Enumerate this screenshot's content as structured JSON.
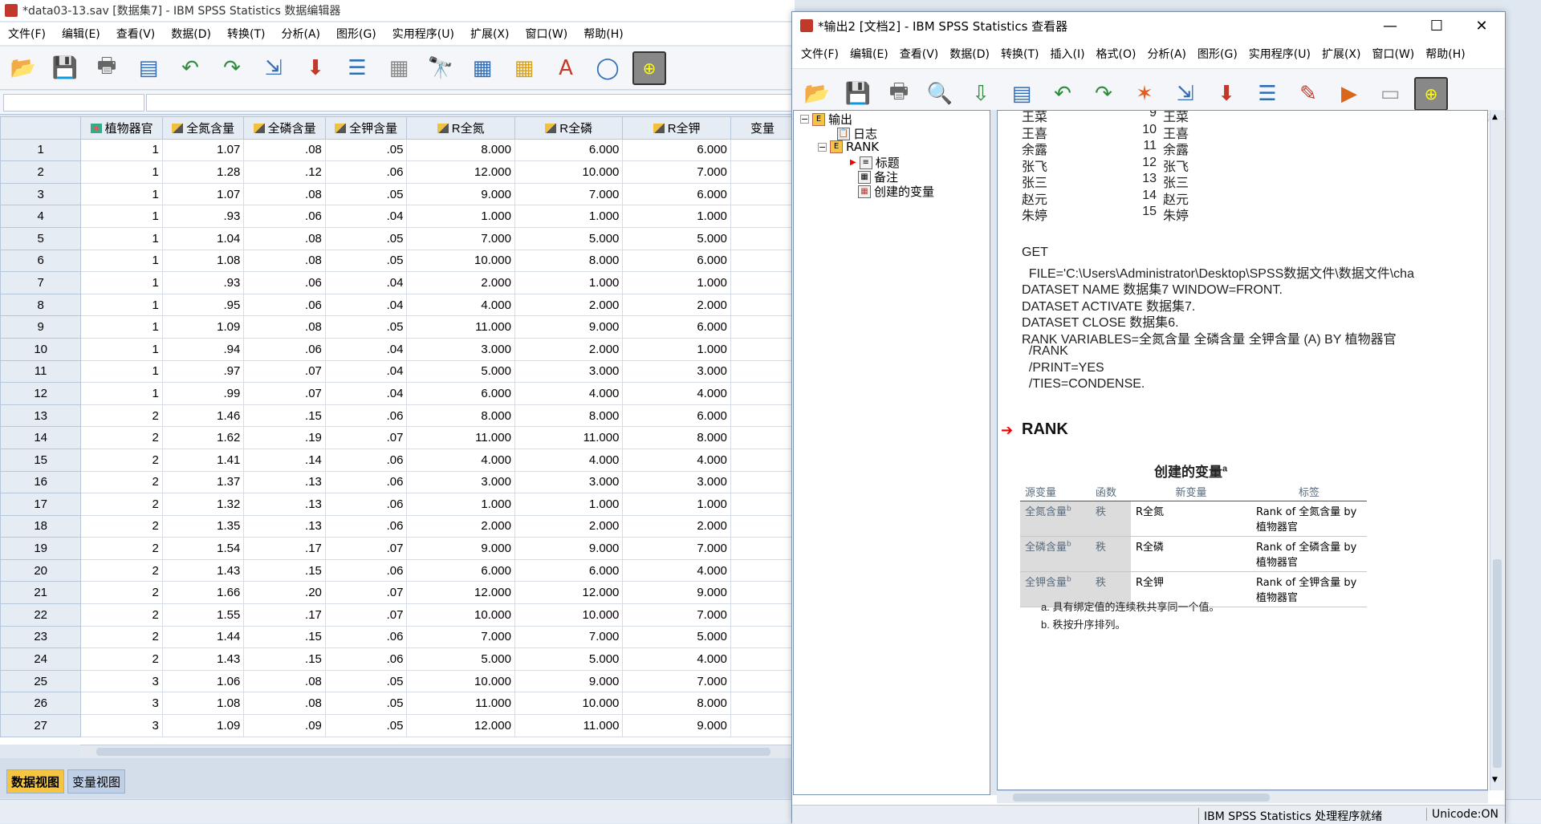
{
  "editor": {
    "title": "*data03-13.sav [数据集7] - IBM SPSS Statistics 数据编辑器",
    "menu": [
      "文件(F)",
      "编辑(E)",
      "查看(V)",
      "数据(D)",
      "转换(T)",
      "分析(A)",
      "图形(G)",
      "实用程序(U)",
      "扩展(X)",
      "窗口(W)",
      "帮助(H)"
    ],
    "columns": [
      "植物器官",
      "全氮含量",
      "全磷含量",
      "全钾含量",
      "R全氮",
      "R全磷",
      "R全钾",
      "变量"
    ],
    "rows": [
      [
        "1",
        "1",
        "1.07",
        ".08",
        ".05",
        "8.000",
        "6.000",
        "6.000"
      ],
      [
        "2",
        "1",
        "1.28",
        ".12",
        ".06",
        "12.000",
        "10.000",
        "7.000"
      ],
      [
        "3",
        "1",
        "1.07",
        ".08",
        ".05",
        "9.000",
        "7.000",
        "6.000"
      ],
      [
        "4",
        "1",
        ".93",
        ".06",
        ".04",
        "1.000",
        "1.000",
        "1.000"
      ],
      [
        "5",
        "1",
        "1.04",
        ".08",
        ".05",
        "7.000",
        "5.000",
        "5.000"
      ],
      [
        "6",
        "1",
        "1.08",
        ".08",
        ".05",
        "10.000",
        "8.000",
        "6.000"
      ],
      [
        "7",
        "1",
        ".93",
        ".06",
        ".04",
        "2.000",
        "1.000",
        "1.000"
      ],
      [
        "8",
        "1",
        ".95",
        ".06",
        ".04",
        "4.000",
        "2.000",
        "2.000"
      ],
      [
        "9",
        "1",
        "1.09",
        ".08",
        ".05",
        "11.000",
        "9.000",
        "6.000"
      ],
      [
        "10",
        "1",
        ".94",
        ".06",
        ".04",
        "3.000",
        "2.000",
        "1.000"
      ],
      [
        "11",
        "1",
        ".97",
        ".07",
        ".04",
        "5.000",
        "3.000",
        "3.000"
      ],
      [
        "12",
        "1",
        ".99",
        ".07",
        ".04",
        "6.000",
        "4.000",
        "4.000"
      ],
      [
        "13",
        "2",
        "1.46",
        ".15",
        ".06",
        "8.000",
        "8.000",
        "6.000"
      ],
      [
        "14",
        "2",
        "1.62",
        ".19",
        ".07",
        "11.000",
        "11.000",
        "8.000"
      ],
      [
        "15",
        "2",
        "1.41",
        ".14",
        ".06",
        "4.000",
        "4.000",
        "4.000"
      ],
      [
        "16",
        "2",
        "1.37",
        ".13",
        ".06",
        "3.000",
        "3.000",
        "3.000"
      ],
      [
        "17",
        "2",
        "1.32",
        ".13",
        ".06",
        "1.000",
        "1.000",
        "1.000"
      ],
      [
        "18",
        "2",
        "1.35",
        ".13",
        ".06",
        "2.000",
        "2.000",
        "2.000"
      ],
      [
        "19",
        "2",
        "1.54",
        ".17",
        ".07",
        "9.000",
        "9.000",
        "7.000"
      ],
      [
        "20",
        "2",
        "1.43",
        ".15",
        ".06",
        "6.000",
        "6.000",
        "4.000"
      ],
      [
        "21",
        "2",
        "1.66",
        ".20",
        ".07",
        "12.000",
        "12.000",
        "9.000"
      ],
      [
        "22",
        "2",
        "1.55",
        ".17",
        ".07",
        "10.000",
        "10.000",
        "7.000"
      ],
      [
        "23",
        "2",
        "1.44",
        ".15",
        ".06",
        "7.000",
        "7.000",
        "5.000"
      ],
      [
        "24",
        "2",
        "1.43",
        ".15",
        ".06",
        "5.000",
        "5.000",
        "4.000"
      ],
      [
        "25",
        "3",
        "1.06",
        ".08",
        ".05",
        "10.000",
        "9.000",
        "7.000"
      ],
      [
        "26",
        "3",
        "1.08",
        ".08",
        ".05",
        "11.000",
        "10.000",
        "8.000"
      ],
      [
        "27",
        "3",
        "1.09",
        ".09",
        ".05",
        "12.000",
        "11.000",
        "9.000"
      ]
    ],
    "tabs": {
      "data_view": "数据视图",
      "variable_view": "变量视图"
    }
  },
  "viewer": {
    "title": "*输出2 [文档2] - IBM SPSS Statistics 查看器",
    "menu": [
      "文件(F)",
      "编辑(E)",
      "查看(V)",
      "数据(D)",
      "转换(T)",
      "插入(I)",
      "格式(O)",
      "分析(A)",
      "图形(G)",
      "实用程序(U)",
      "扩展(X)",
      "窗口(W)",
      "帮助(H)"
    ],
    "side_label": "变量",
    "tree": {
      "root": "输出",
      "log": "日志",
      "rank": "RANK",
      "title": "标题",
      "notes": "备注",
      "created": "创建的变量"
    },
    "name_list": [
      [
        "王菜",
        "9",
        "王菜"
      ],
      [
        "王喜",
        "10",
        "王喜"
      ],
      [
        "余露",
        "11",
        "余露"
      ],
      [
        "张飞",
        "12",
        "张飞"
      ],
      [
        "张三",
        "13",
        "张三"
      ],
      [
        "赵元",
        "14",
        "赵元"
      ],
      [
        "朱婷",
        "15",
        "朱婷"
      ]
    ],
    "syntax": [
      "GET",
      "  FILE='C:\\Users\\Administrator\\Desktop\\SPSS数据文件\\数据文件\\cha",
      "DATASET NAME 数据集7 WINDOW=FRONT.",
      "DATASET ACTIVATE 数据集7.",
      "DATASET CLOSE 数据集6.",
      "RANK VARIABLES=全氮含量 全磷含量 全钾含量 (A) BY 植物器官",
      "  /RANK",
      "  /PRINT=YES",
      "  /TIES=CONDENSE."
    ],
    "heading": "RANK",
    "table_title": "创建的变量",
    "table_title_sup": "a",
    "table_headers": [
      "源变量",
      "函数",
      "新变量",
      "标签"
    ],
    "table_rows": [
      [
        "全氮含量",
        "b",
        "秩",
        "R全氮",
        "Rank of 全氮含量 by 植物器官"
      ],
      [
        "全磷含量",
        "b",
        "秩",
        "R全磷",
        "Rank of 全磷含量 by 植物器官"
      ],
      [
        "全钾含量",
        "b",
        "秩",
        "R全钾",
        "Rank of 全钾含量 by 植物器官"
      ]
    ],
    "footnotes": [
      "a. 具有绑定值的连续秩共享同一个值。",
      "b. 秩按升序排列。"
    ],
    "status": "IBM SPSS Statistics 处理程序就绪",
    "unicode": "Unicode:ON"
  }
}
